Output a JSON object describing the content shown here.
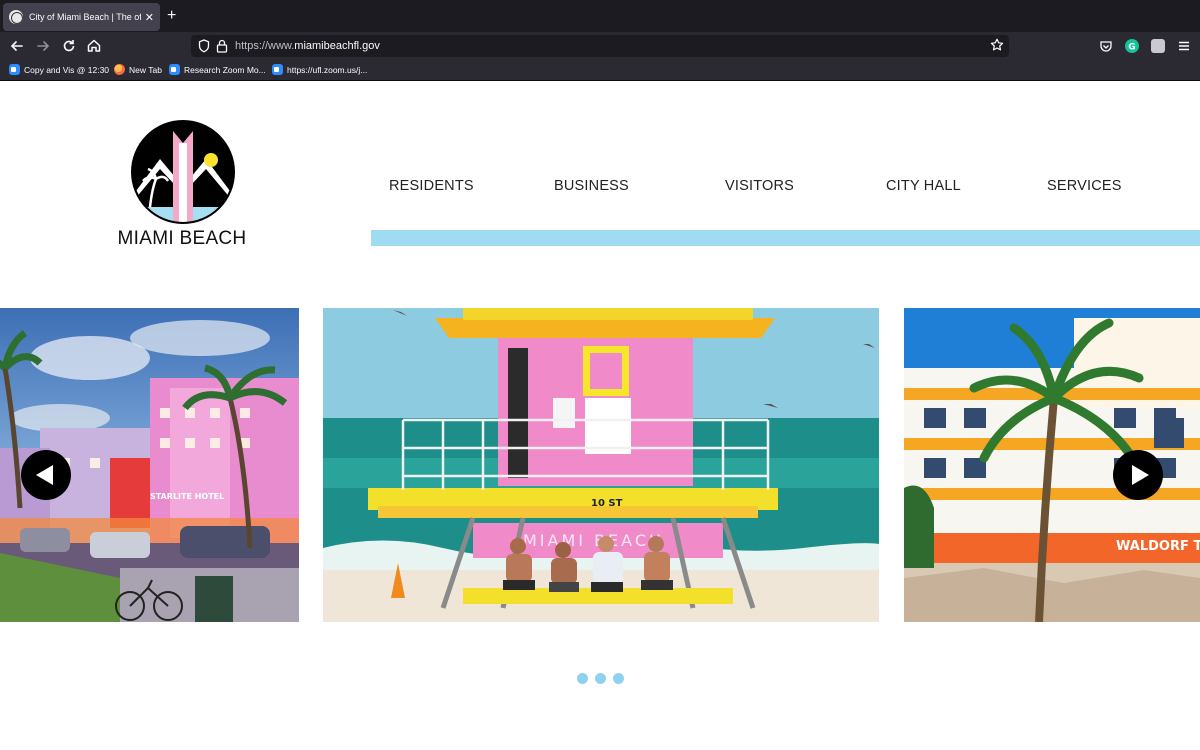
{
  "browser": {
    "tab_title": "City of Miami Beach | The officia",
    "tab_close": "✕",
    "new_tab": "+",
    "url_prefix": "https://www.",
    "url_host": "miamibeachfl.gov",
    "bookmarks": [
      {
        "label": "Copy and Vis @ 12:30",
        "icon": "zoom-icon"
      },
      {
        "label": "New Tab",
        "icon": "firefox-icon"
      },
      {
        "label": "Research Zoom Mo...",
        "icon": "zoom-icon"
      },
      {
        "label": "https://ufl.zoom.us/j...",
        "icon": "zoom-icon"
      }
    ]
  },
  "site": {
    "logo_text": "MIAMI BEACH",
    "nav": [
      "RESIDENTS",
      "BUSINESS",
      "VISITORS",
      "CITY HALL",
      "SERVICES"
    ],
    "accent_color": "#9fdcf3",
    "carousel": {
      "slides": [
        {
          "description_icon": "ocean-drive-night-image",
          "sign": "STARLITE HOTEL"
        },
        {
          "description_icon": "lifeguard-tower-image",
          "sign": "10 ST",
          "banner": "MIAMI BEACH"
        },
        {
          "description_icon": "waldorf-towers-image",
          "sign": "WALDORF T"
        }
      ],
      "dot_count": 3,
      "dot_color": "#8fd2ef"
    }
  }
}
